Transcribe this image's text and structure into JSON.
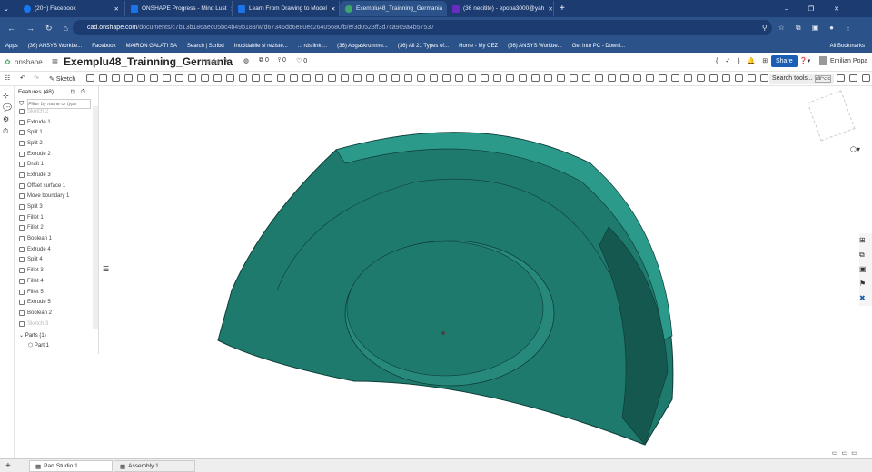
{
  "browser": {
    "tabs": [
      {
        "label": "(20+) Facebook",
        "color": "#1877f2"
      },
      {
        "label": "ONSHAPE Progress - Mind Lust",
        "color": "#1a73e8"
      },
      {
        "label": "Learn From Drawing to Model",
        "color": "#1a73e8"
      },
      {
        "label": "Exemplu48_Trainning_Germania",
        "color": "#3fa66b",
        "active": true
      },
      {
        "label": "(36 necitite) - epopa3000@yah",
        "color": "#6a2bbf"
      }
    ],
    "url_host": "cad.onshape.com",
    "url_path": "/documents/c7b13b186aec05bc4b49b183/w/d67346dd6e80ec26405680fb/e/3d0523ff3d7ca9c9a4b57537",
    "bookmarks": [
      "Apps",
      "(36) ANSYS Workbe...",
      "Facebook",
      "MAIRON GALATI SA",
      "Search | Scribd",
      "Inoxidabile și reziste...",
      ".:: rds.link ::.",
      "(36) Abgaskrumme...",
      "(36) All 21 Types of...",
      "Home - My CEZ",
      "(36) ANSYS Workbe...",
      "Get Into PC - Downl..."
    ],
    "all_bookmarks": "All Bookmarks"
  },
  "onshape": {
    "logo": "onshape",
    "doc_title": "Exemplu48_Trainning_Germania",
    "branch": "Main",
    "versions": "0",
    "branches": "0",
    "likes": "0",
    "share": "Share",
    "user": "Emilian Popa",
    "sketch": "Sketch",
    "search_tools": "Search tools...",
    "search_shortcut": "alt/⌥ c"
  },
  "features": {
    "header": "Features (48)",
    "filter_placeholder": "Filter by name or type",
    "items": [
      "Sketch 2",
      "Extrude 1",
      "Split 1",
      "Split 2",
      "Extrude 2",
      "Draft 1",
      "Extrude 3",
      "Offset surface 1",
      "Move boundary 1",
      "Split 3",
      "Fillet 1",
      "Fillet 2",
      "Boolean 1",
      "Extrude 4",
      "Split 4",
      "Fillet 3",
      "Fillet 4",
      "Fillet 5",
      "Extrude 5",
      "Boolean 2",
      "Sketch 3"
    ],
    "parts_header": "Parts (1)",
    "parts": [
      "Part 1"
    ]
  },
  "bottom_tabs": [
    "Part Studio 1",
    "Assembly 1"
  ],
  "colors": {
    "part": "#1f7a6e",
    "part_dark": "#14584f",
    "part_light": "#2b9a8a"
  }
}
